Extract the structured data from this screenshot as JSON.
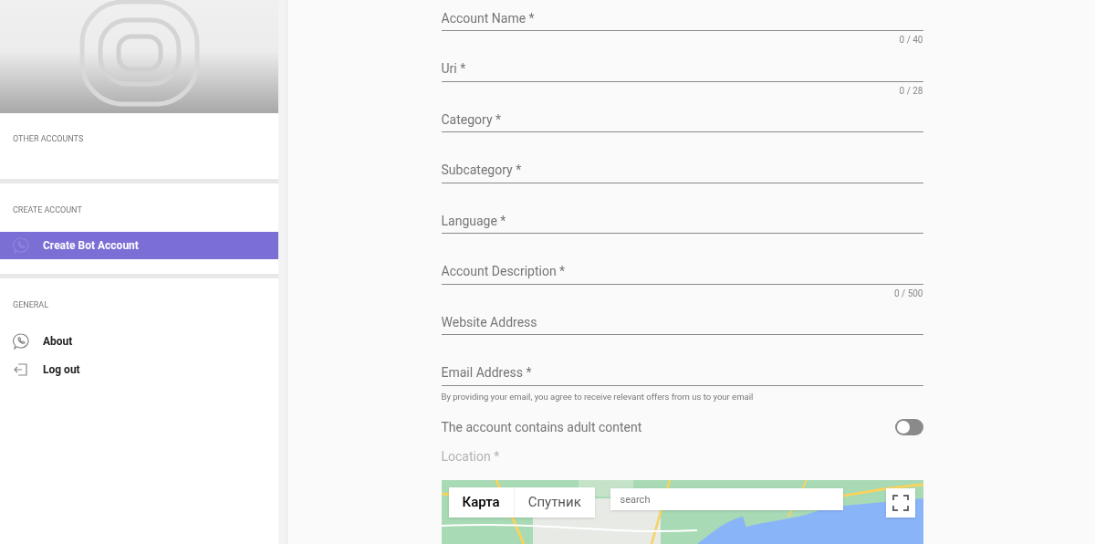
{
  "sidebar": {
    "sections": [
      {
        "title": "OTHER ACCOUNTS"
      },
      {
        "title": "CREATE ACCOUNT",
        "items": [
          {
            "label": "Create Bot Account",
            "kind": "bubble",
            "selected": true
          }
        ]
      },
      {
        "title": "GENERAL",
        "items": [
          {
            "label": "About",
            "kind": "bubble",
            "selected": false
          },
          {
            "label": "Log out",
            "kind": "logout",
            "selected": false
          }
        ]
      }
    ]
  },
  "form": {
    "fields": [
      {
        "placeholder": "Account Name *",
        "counter": "0 / 40"
      },
      {
        "placeholder": "Uri *",
        "counter": "0 / 28"
      },
      {
        "placeholder": "Category *"
      },
      {
        "placeholder": "Subcategory *"
      },
      {
        "placeholder": "Language *"
      },
      {
        "placeholder": "Account Description *",
        "counter": "0 / 500"
      },
      {
        "placeholder": "Website Address"
      },
      {
        "placeholder": "Email Address *",
        "hint": "By providing your email, you agree to receive relevant offers from us to your email"
      }
    ],
    "adult_toggle": {
      "label": "The account contains adult content",
      "on": false
    },
    "location": {
      "label": "Location *",
      "map_types": [
        {
          "label": "Карта",
          "selected": true
        },
        {
          "label": "Спутник",
          "selected": false
        }
      ],
      "search": {
        "placeholder": "search"
      }
    }
  }
}
